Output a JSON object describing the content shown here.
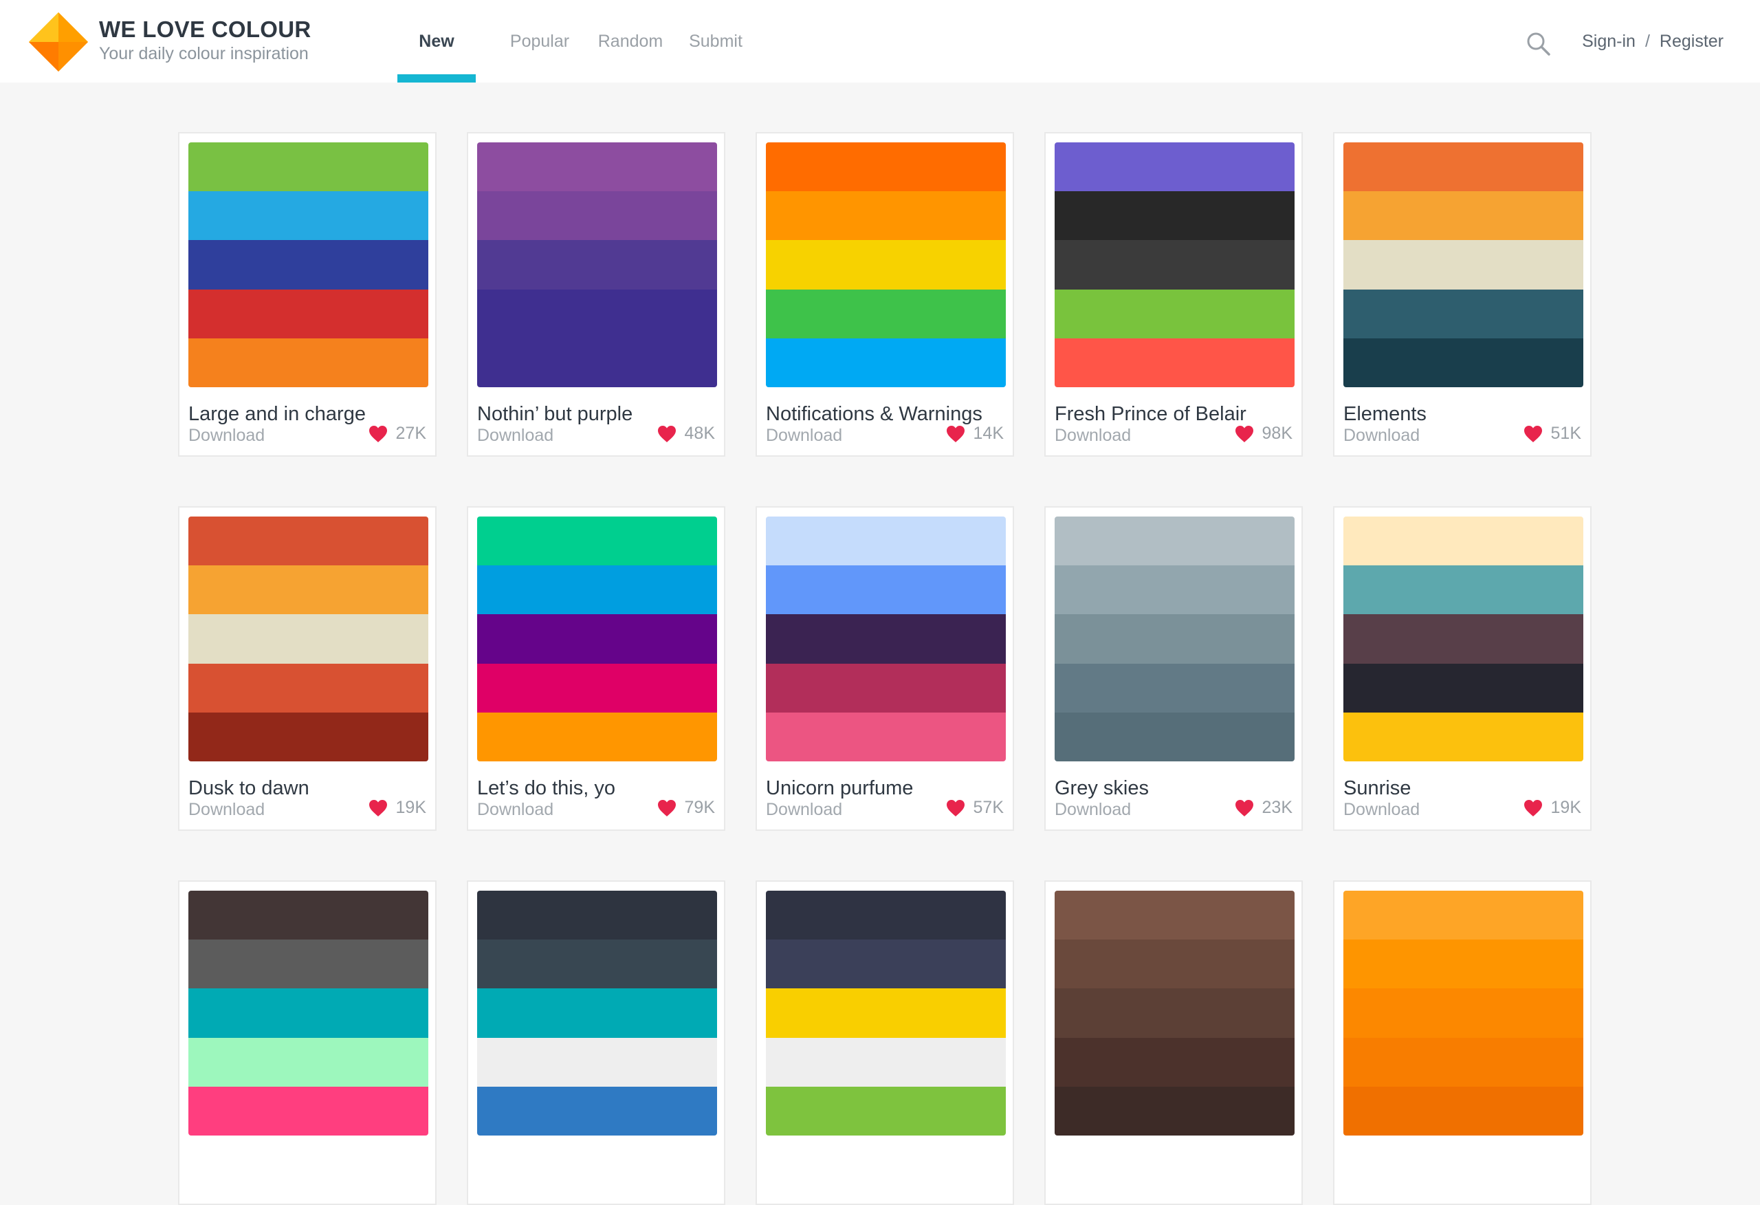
{
  "brand": {
    "title": "WE LOVE COLOUR",
    "subtitle": "Your daily colour inspiration",
    "logo_icon": "diamond-logo-icon"
  },
  "nav": {
    "tabs": [
      {
        "label": "New",
        "active": true
      },
      {
        "label": "Popular",
        "active": false
      },
      {
        "label": "Random",
        "active": false
      },
      {
        "label": "Submit",
        "active": false
      }
    ],
    "active_indicator_color": "#15b6d2"
  },
  "header": {
    "search_icon": "search-icon",
    "signin_label": "Sign-in",
    "separator": "/",
    "register_label": "Register"
  },
  "palettes": [
    {
      "name": "Large and in charge",
      "download_label": "Download",
      "likes": "27K",
      "colors": [
        "#79c143",
        "#25a9e2",
        "#2f3f9c",
        "#d42f2e",
        "#f5811d"
      ]
    },
    {
      "name": "Nothin’ but purple",
      "download_label": "Download",
      "likes": "48K",
      "colors": [
        "#8d4da0",
        "#7a459b",
        "#513a93",
        "#3f2f90",
        "#3f2f90"
      ]
    },
    {
      "name": "Notifications & Warnings",
      "download_label": "Download",
      "likes": "14K",
      "colors": [
        "#ff6c00",
        "#ff9500",
        "#f7d200",
        "#3ec24a",
        "#00a9f3"
      ]
    },
    {
      "name": "Fresh Prince of Belair",
      "download_label": "Download",
      "likes": "98K",
      "colors": [
        "#6d5ecf",
        "#282828",
        "#3b3b3b",
        "#79c33d",
        "#ff5548"
      ]
    },
    {
      "name": "Elements",
      "download_label": "Download",
      "likes": "51K",
      "colors": [
        "#ee7131",
        "#f6a332",
        "#e3dec5",
        "#2e5e6e",
        "#193e4c"
      ]
    },
    {
      "name": "Dusk to dawn",
      "download_label": "Download",
      "likes": "19K",
      "colors": [
        "#d85132",
        "#f6a332",
        "#e3dec5",
        "#d85132",
        "#922819"
      ]
    },
    {
      "name": "Let’s do this, yo",
      "download_label": "Download",
      "likes": "79K",
      "colors": [
        "#00cf8f",
        "#009ee0",
        "#65048a",
        "#df0066",
        "#ff9600"
      ]
    },
    {
      "name": "Unicorn purfume",
      "download_label": "Download",
      "likes": "57K",
      "colors": [
        "#c5dcfc",
        "#6197fa",
        "#3b2352",
        "#b22e5a",
        "#ec5582"
      ]
    },
    {
      "name": "Grey skies",
      "download_label": "Download",
      "likes": "23K",
      "colors": [
        "#b1bec4",
        "#92a6ae",
        "#7b9199",
        "#627a86",
        "#566e79"
      ]
    },
    {
      "name": "Sunrise",
      "download_label": "Download",
      "likes": "19K",
      "colors": [
        "#ffe9bd",
        "#5da8ad",
        "#583f49",
        "#262630",
        "#fcc10d"
      ]
    },
    {
      "name": "",
      "download_label": "",
      "likes": "",
      "colors": [
        "#433636",
        "#5c5c5c",
        "#00aab4",
        "#9df7bd",
        "#ff3e7f"
      ]
    },
    {
      "name": "",
      "download_label": "",
      "likes": "",
      "colors": [
        "#2e3440",
        "#384752",
        "#00aab4",
        "#eeeeee",
        "#2f7ac3"
      ]
    },
    {
      "name": "",
      "download_label": "",
      "likes": "",
      "colors": [
        "#2f3343",
        "#3b4059",
        "#f9cf00",
        "#eeeeee",
        "#7ec33e"
      ]
    },
    {
      "name": "",
      "download_label": "",
      "likes": "",
      "colors": [
        "#7b5546",
        "#6a493c",
        "#5c4036",
        "#4c322c",
        "#3d2b27"
      ]
    },
    {
      "name": "",
      "download_label": "",
      "likes": "",
      "colors": [
        "#fea526",
        "#fe9500",
        "#fc8800",
        "#f87d00",
        "#f07000"
      ]
    }
  ],
  "card_icons": {
    "like_icon": "heart-icon"
  }
}
